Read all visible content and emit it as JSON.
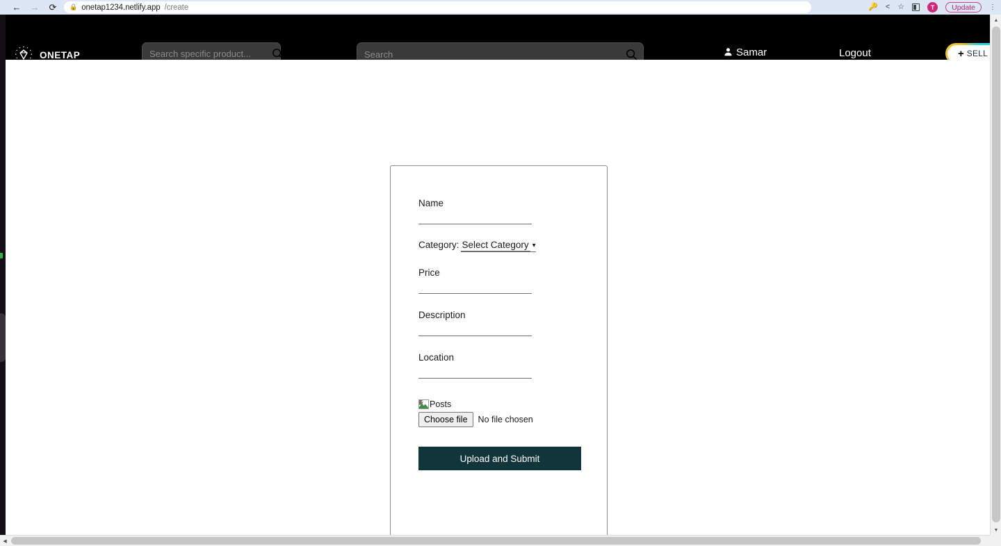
{
  "browser": {
    "back_icon": "back-arrow-icon",
    "forward_icon": "forward-arrow-icon",
    "reload_icon": "reload-icon",
    "lock_icon": "lock-icon",
    "url_host": "onetap1234.netlify.app",
    "url_path": "/create",
    "key_icon": "key-icon",
    "share_icon": "share-icon",
    "bookmark_icon": "star-icon",
    "split_icon": "side-panel-icon",
    "profile_initial": "T",
    "update_label": "Update",
    "menu_icon": "kebab-menu-icon"
  },
  "navbar": {
    "logo_icon": "diamond-logo-icon",
    "logo_text": "ONETAP",
    "search_small_placeholder": "Search specific product...",
    "search_small_value": "",
    "search_big_placeholder": "Search",
    "search_big_value": "",
    "search_icon": "search-icon",
    "user_icon": "person-icon",
    "user_name": "Samar",
    "logout_label": "Logout",
    "sell_plus": "+",
    "sell_label": "SELL"
  },
  "form": {
    "name_label": "Name",
    "name_value": "",
    "category_label": "Category:",
    "category_selected": "Select Category",
    "category_options": [
      "Select Category"
    ],
    "category_chevron_icon": "chevron-down-icon",
    "price_label": "Price",
    "price_value": "",
    "description_label": "Description",
    "description_value": "",
    "location_label": "Location",
    "location_value": "",
    "image_alt": "Posts",
    "broken_image_icon": "broken-image-icon",
    "choose_file_label": "Choose file",
    "no_file_label": "No file chosen",
    "submit_label": "Upload and Submit"
  },
  "scrollbars": {
    "v_up_icon": "scroll-up-icon",
    "v_down_icon": "scroll-down-icon",
    "h_left_icon": "scroll-left-icon",
    "h_right_icon": "scroll-right-icon"
  },
  "colors": {
    "navbar_bg": "#000000",
    "submit_bg": "#12343b",
    "avatar_bg": "#d0287d",
    "search_bg": "#3a3a3a"
  }
}
